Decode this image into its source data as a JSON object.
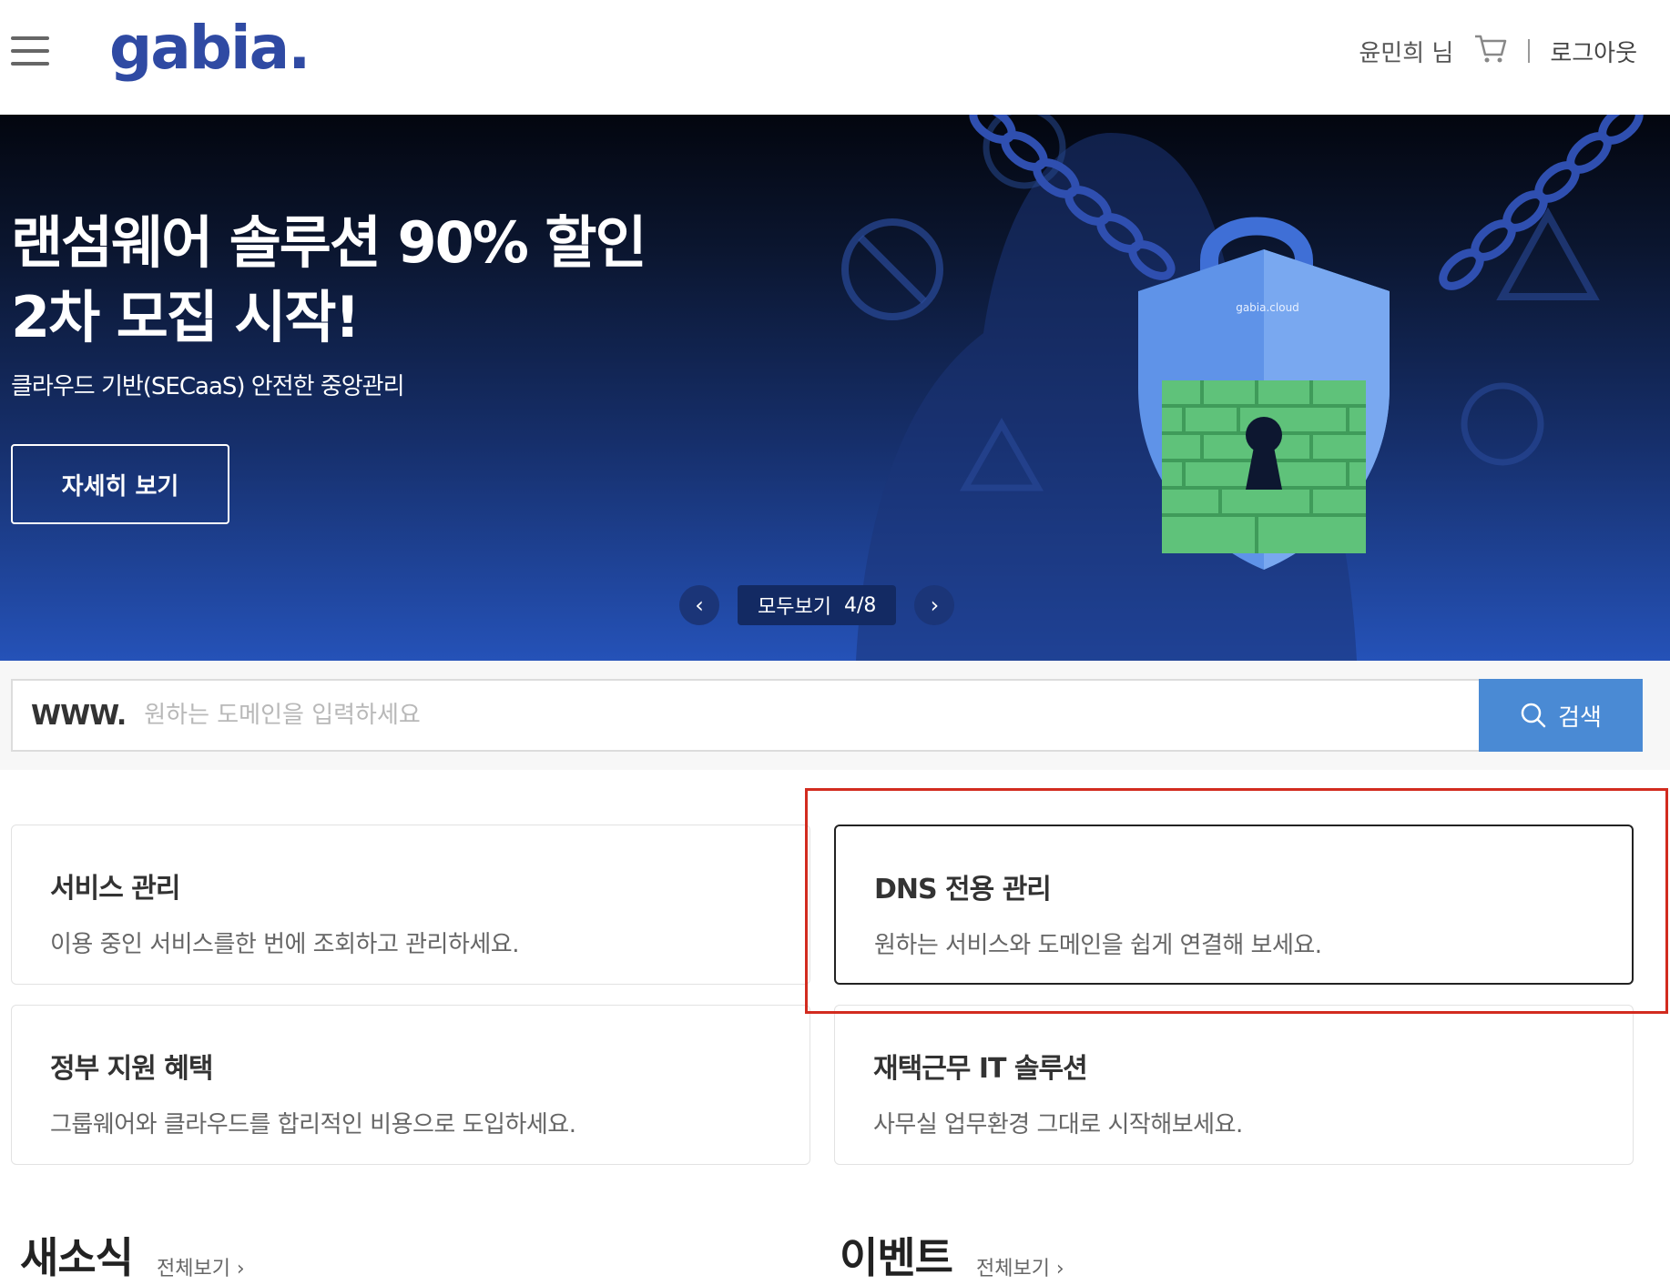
{
  "header": {
    "logo_text": "gabia",
    "logo_dot": ".",
    "user_name": "윤민희 님",
    "cart_icon": "cart-icon",
    "logout_label": "로그아웃"
  },
  "banner": {
    "title_line1": "랜섬웨어 솔루션 90% 할인",
    "title_line2": "2차 모집 시작!",
    "subtitle": "클라우드 기반(SECaaS) 안전한 중앙관리",
    "detail_button": "자세히 보기",
    "brand_tag": "gabia.cloud",
    "pager": {
      "view_all_label": "모두보기",
      "current": "4",
      "separator": "/",
      "total": "8",
      "prev_icon": "‹",
      "next_icon": "›"
    }
  },
  "search": {
    "prefix": "WWW.",
    "placeholder": "원하는 도메인을 입력하세요",
    "button_label": "검색"
  },
  "cards": [
    {
      "title": "서비스 관리",
      "desc": "이용 중인 서비스를한 번에 조회하고 관리하세요."
    },
    {
      "title": "DNS 전용 관리",
      "desc": "원하는 서비스와 도메인을 쉽게 연결해 보세요."
    },
    {
      "title": "정부 지원 혜택",
      "desc": "그룹웨어와 클라우드를 합리적인 비용으로 도입하세요."
    },
    {
      "title": "재택근무 IT 솔루션",
      "desc": "사무실 업무환경 그대로 시작해보세요."
    }
  ],
  "sections": {
    "news_title": "새소식",
    "news_more": "전체보기 ›",
    "events_title": "이벤트",
    "events_more": "전체보기 ›"
  },
  "colors": {
    "brand": "#2f4aa3",
    "search_button": "#4a8ad4",
    "highlight": "#d22b1f"
  }
}
